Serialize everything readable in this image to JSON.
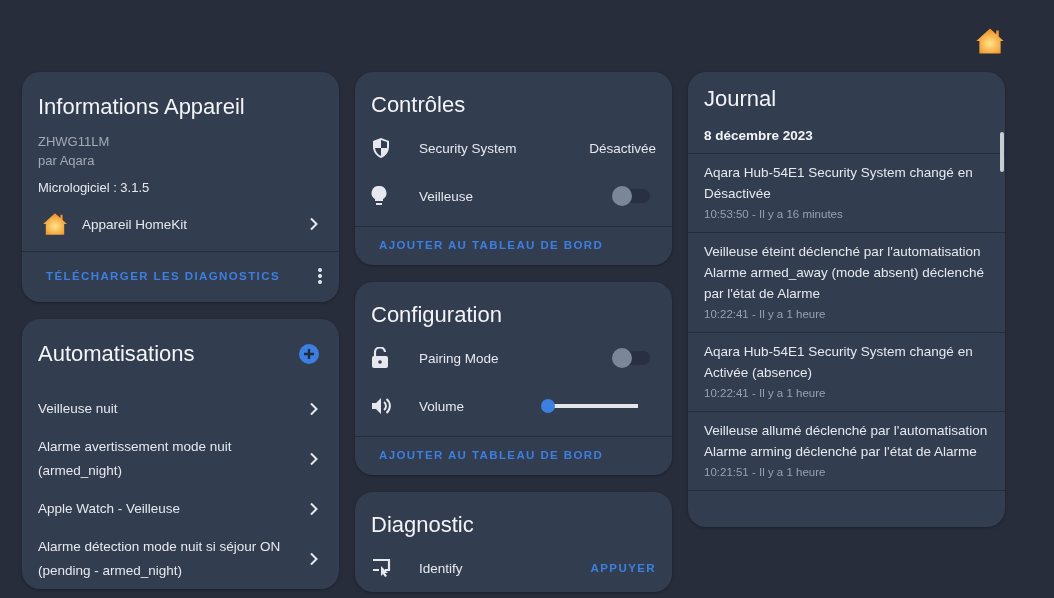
{
  "device_info": {
    "title": "Informations Appareil",
    "model": "ZHWG11LM",
    "manufacturer": "par Aqara",
    "firmware": "Micrologiciel : 3.1.5",
    "link": "Appareil HomeKit",
    "action": "TÉLÉCHARGER LES DIAGNOSTICS"
  },
  "automations": {
    "title": "Automatisations",
    "items": [
      {
        "label": "Veilleuse nuit"
      },
      {
        "label": "Alarme avertissement mode nuit (armed_night)"
      },
      {
        "label": "Apple Watch - Veilleuse"
      },
      {
        "label": "Alarme détection mode nuit si séjour ON (pending - armed_night)"
      }
    ]
  },
  "controls": {
    "title": "Contrôles",
    "entities": [
      {
        "kind": "state",
        "name": "Security System",
        "state": "Désactivée"
      },
      {
        "kind": "toggle",
        "name": "Veilleuse",
        "on": false
      }
    ],
    "action": "AJOUTER AU TABLEAU DE BORD"
  },
  "configuration": {
    "title": "Configuration",
    "entities": [
      {
        "kind": "toggle",
        "name": "Pairing Mode",
        "on": false
      },
      {
        "kind": "slider",
        "name": "Volume",
        "level": 0.0
      }
    ],
    "action": "AJOUTER AU TABLEAU DE BORD"
  },
  "diagnostic": {
    "title": "Diagnostic",
    "entities": [
      {
        "kind": "button",
        "name": "Identify",
        "action": "APPUYER"
      }
    ]
  },
  "journal": {
    "title": "Journal",
    "date": "8 décembre 2023",
    "entries": [
      {
        "message": "Aqara Hub-54E1 Security System changé en Désactivée",
        "time": "10:53:50 - Il y a 16 minutes"
      },
      {
        "message": "Veilleuse éteint déclenché par l'automatisation Alarme armed_away (mode absent) déclenché par l'état de Alarme",
        "time": "10:22:41 - Il y a 1 heure"
      },
      {
        "message": "Aqara Hub-54E1 Security System changé en Activée (absence)",
        "time": "10:22:41 - Il y a 1 heure"
      },
      {
        "message": "Veilleuse allumé déclenché par l'automatisation Alarme arming déclenché par l'état de Alarme",
        "time": "10:21:51 - Il y a 1 heure"
      }
    ]
  }
}
